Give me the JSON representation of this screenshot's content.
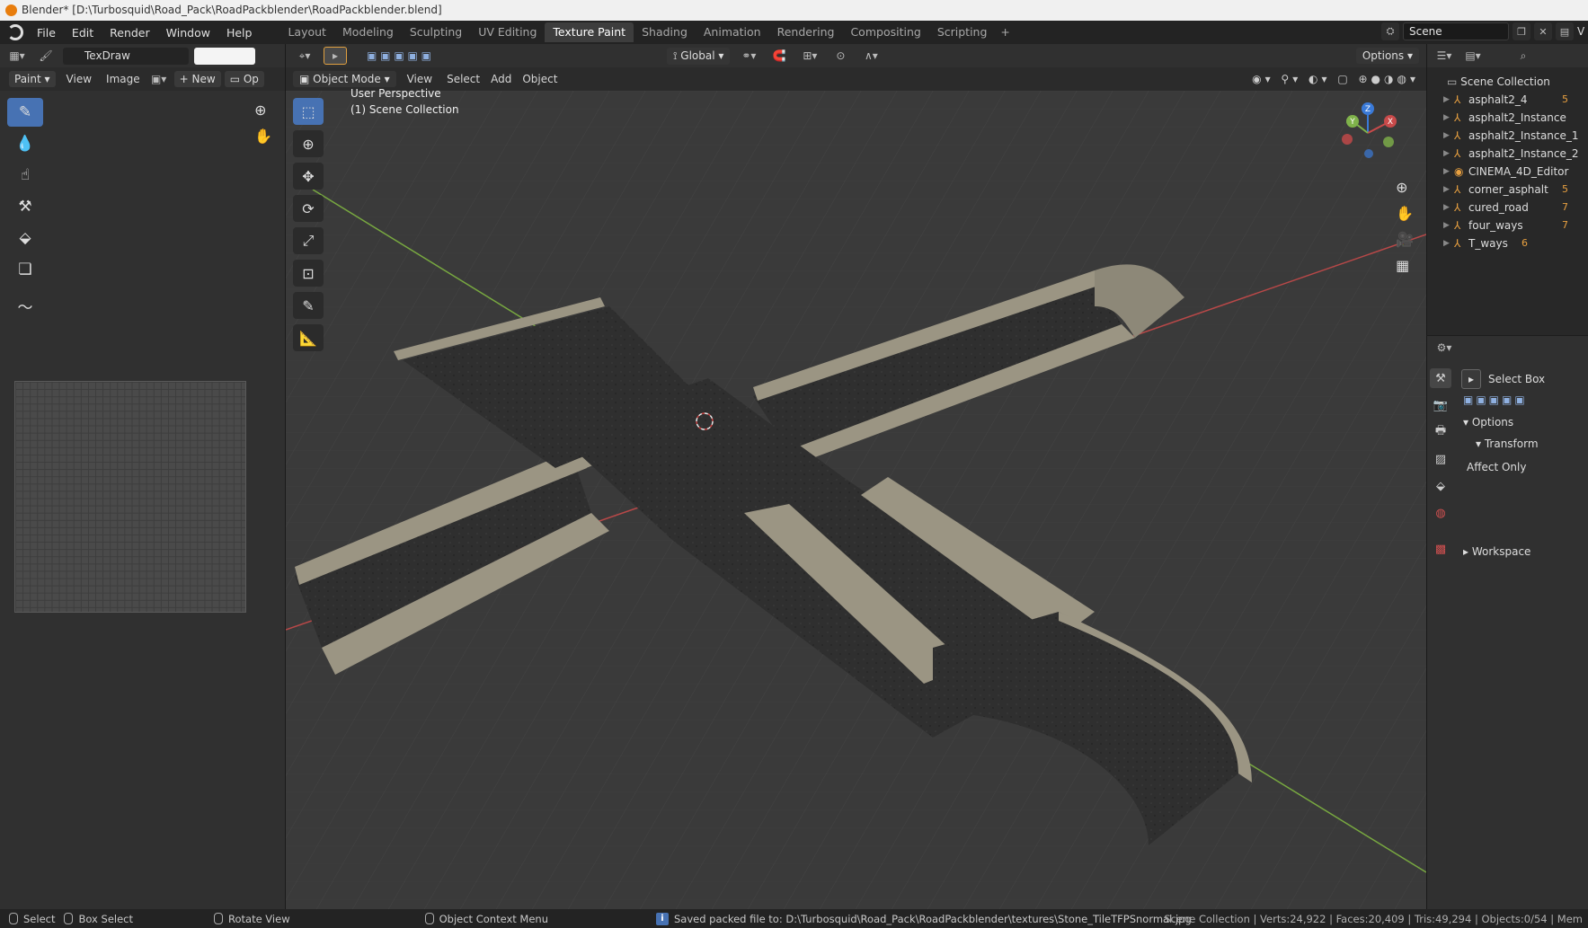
{
  "titlebar": {
    "title": "Blender* [D:\\Turbosquid\\Road_Pack\\RoadPackblender\\RoadPackblender.blend]"
  },
  "menu": [
    "File",
    "Edit",
    "Render",
    "Window",
    "Help"
  ],
  "workspace_tabs": [
    "Layout",
    "Modeling",
    "Sculpting",
    "UV Editing",
    "Texture Paint",
    "Shading",
    "Animation",
    "Rendering",
    "Compositing",
    "Scripting"
  ],
  "active_tab": "Texture Paint",
  "scene": {
    "name": "Scene",
    "view_layer_partial": "V"
  },
  "image_editor": {
    "brush_name": "TexDraw",
    "mode": "Paint",
    "menus": [
      "View",
      "Image"
    ],
    "new_label": "New",
    "open_label": "Op",
    "tools": [
      "brush-icon",
      "fill-drop-icon",
      "smear-icon",
      "stamp-icon",
      "fill-bucket-icon",
      "mask-icon",
      "annotate-icon"
    ]
  },
  "viewport": {
    "mode": "Object Mode",
    "menus": [
      "View",
      "Select",
      "Add",
      "Object"
    ],
    "transform_orientation": "Global",
    "options_label": "Options",
    "overlay_line1": "User Perspective",
    "overlay_line2": "(1) Scene Collection",
    "gizmo": {
      "x": "X",
      "y": "Y",
      "z": "Z"
    }
  },
  "outliner": {
    "root": "Scene Collection",
    "items": [
      {
        "name": "asphalt2_4",
        "mod": "5"
      },
      {
        "name": "asphalt2_Instance",
        "mod": ""
      },
      {
        "name": "asphalt2_Instance_1",
        "mod": ""
      },
      {
        "name": "asphalt2_Instance_2",
        "mod": ""
      },
      {
        "name": "CINEMA_4D_Editor",
        "mod": ""
      },
      {
        "name": "corner_asphalt",
        "mod": "5"
      },
      {
        "name": "cured_road",
        "mod": "7"
      },
      {
        "name": "four_ways",
        "mod": "7"
      },
      {
        "name": "T_ways",
        "mod": "6"
      }
    ]
  },
  "properties": {
    "tool_name": "Select Box",
    "options_label": "Options",
    "transform_label": "Transform",
    "affect_only_label": "Affect Only",
    "workspace_label": "Workspace"
  },
  "statusbar": {
    "select": "Select",
    "box_select": "Box Select",
    "rotate_view": "Rotate View",
    "context_menu": "Object Context Menu",
    "message": "Saved packed file to: D:\\Turbosquid\\Road_Pack\\RoadPackblender\\textures\\Stone_TileTFPSnormal.jpg",
    "stats": "Scene Collection | Verts:24,922 | Faces:20,409 | Tris:49,294 | Objects:0/54 | Mem"
  },
  "colors": {
    "accent": "#4772b3",
    "x_axis": "#c84a4a",
    "y_axis": "#7fb24a",
    "background": "#3a3a3a"
  }
}
